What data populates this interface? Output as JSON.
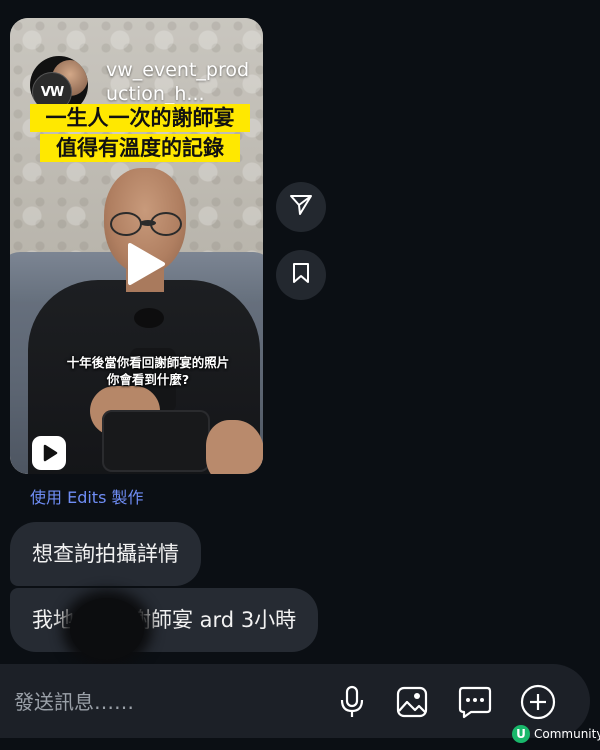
{
  "reel": {
    "account_name": "vw_event_production_h...",
    "avatar_badge": "VW",
    "banner_line1": "一生人一次的謝師宴",
    "banner_line2": "值得有溫度的記錄",
    "caption_line1": "十年後當你看回謝師宴的照片",
    "caption_line2": "你會看到什麼?"
  },
  "edits_link": "使用 Edits 製作",
  "messages": [
    {
      "text": "想查詢拍攝詳情"
    },
    {
      "text_start": "我地",
      "text_end": "謝師宴 ard 3小時"
    }
  ],
  "composer": {
    "placeholder": "發送訊息……"
  },
  "watermark": "Community",
  "icons": [
    "play-icon",
    "reel-icon",
    "send-icon",
    "bookmark-icon",
    "microphone-icon",
    "image-icon",
    "sticker-icon",
    "plus-icon"
  ],
  "colors": {
    "link": "#6f8df5",
    "banner": "#ffe800",
    "bubble": "#262b33",
    "background": "#0b0f14"
  }
}
